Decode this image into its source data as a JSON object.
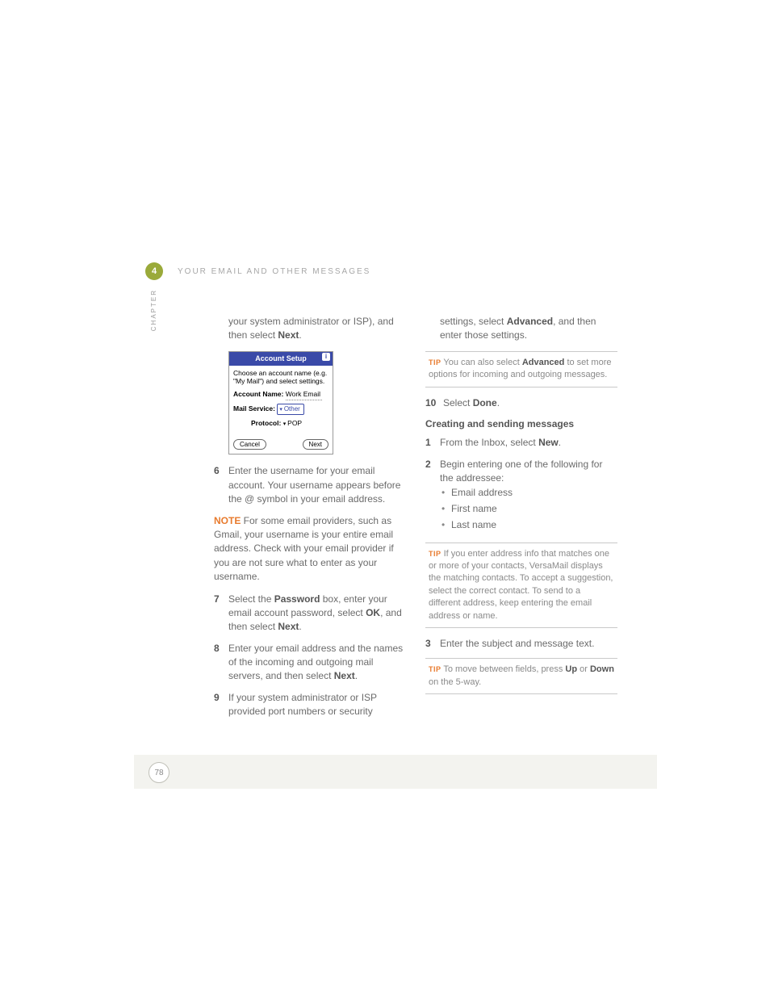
{
  "header": {
    "chapter_number": "4",
    "chapter_word": "CHAPTER",
    "title": "YOUR EMAIL AND OTHER MESSAGES"
  },
  "left": {
    "intro": {
      "prefix": "your system administrator or ISP), and then select ",
      "bold": "Next",
      "suffix": "."
    },
    "screenshot": {
      "title": "Account Setup",
      "desc": "Choose an account name (e.g. \"My Mail\") and select settings.",
      "acct_label": "Account Name:",
      "acct_value": "Work Email",
      "svc_label": "Mail Service:",
      "svc_value": "Other",
      "proto_label": "Protocol:",
      "proto_value": "POP",
      "cancel": "Cancel",
      "next": "Next"
    },
    "step6": {
      "num": "6",
      "text": "Enter the username for your email account. Your username appears before the @ symbol in your email address."
    },
    "note": {
      "label": "NOTE",
      "text": " For some email providers, such as Gmail, your username is your entire email address. Check with your email provider if you are not sure what to enter as your username."
    },
    "step7": {
      "num": "7",
      "a": "Select the ",
      "b": "Password",
      "c": " box, enter your email account password, select ",
      "d": "OK",
      "e": ", and then select ",
      "f": "Next",
      "g": "."
    },
    "step8": {
      "num": "8",
      "a": "Enter your email address and the names of the incoming and outgoing mail servers, and then select ",
      "b": "Next",
      "c": "."
    },
    "step9": {
      "num": "9",
      "a": "If your system administrator or ISP provided port numbers or security "
    }
  },
  "right": {
    "cont9": {
      "a": "settings, select ",
      "b": "Advanced",
      "c": ", and then enter those settings."
    },
    "tip1": {
      "label": "TIP",
      "a": " You can also select ",
      "b": "Advanced",
      "c": " to set more options for incoming and outgoing messages."
    },
    "step10": {
      "num": "10",
      "a": "Select ",
      "b": "Done",
      "c": "."
    },
    "subhead": "Creating and sending messages",
    "step1": {
      "num": "1",
      "a": "From the Inbox, select ",
      "b": "New",
      "c": "."
    },
    "step2": {
      "num": "2",
      "a": "Begin entering one of the following for the addressee:",
      "bullets": [
        "Email address",
        "First name",
        "Last name"
      ]
    },
    "tip2": {
      "label": "TIP",
      "text": " If you enter address info that matches one or more of your contacts, VersaMail displays the matching contacts. To accept a suggestion, select the correct contact. To send to a different address, keep entering the email address or name."
    },
    "step3": {
      "num": "3",
      "a": "Enter the subject and message text."
    },
    "tip3": {
      "label": "TIP",
      "a": " To move between fields, press ",
      "b": "Up",
      "c": " or ",
      "d": "Down",
      "e": " on the 5-way."
    }
  },
  "page_number": "78"
}
